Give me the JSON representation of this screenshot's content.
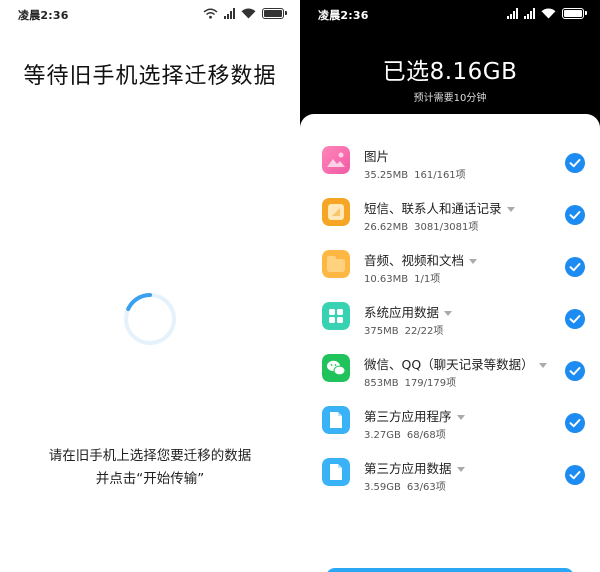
{
  "left": {
    "status_time": "凌晨2:36",
    "title": "等待旧手机选择迁移数据",
    "hint_line1": "请在旧手机上选择您要迁移的数据",
    "hint_line2": "并点击“开始传输”"
  },
  "right": {
    "status_time": "凌晨2:36",
    "title": "已选8.16GB",
    "subtitle": "预计需要10分钟",
    "items": [
      {
        "name": "图片",
        "size": "35.25MB",
        "count": "161/161项",
        "icon": "photos-icon",
        "has_caret": false,
        "checked": true
      },
      {
        "name": "短信、联系人和通话记录",
        "size": "26.62MB",
        "count": "3081/3081项",
        "icon": "messages-contacts-icon",
        "has_caret": true,
        "checked": true
      },
      {
        "name": "音频、视频和文档",
        "size": "10.63MB",
        "count": "1/1项",
        "icon": "media-documents-icon",
        "has_caret": true,
        "checked": true
      },
      {
        "name": "系统应用数据",
        "size": "375MB",
        "count": "22/22项",
        "icon": "system-apps-icon",
        "has_caret": true,
        "checked": true
      },
      {
        "name": "微信、QQ（聊天记录等数据）",
        "size": "853MB",
        "count": "179/179项",
        "icon": "wechat-icon",
        "has_caret": true,
        "checked": true
      },
      {
        "name": "第三方应用程序",
        "size": "3.27GB",
        "count": "68/68项",
        "icon": "third-party-apps-icon",
        "has_caret": true,
        "checked": true
      },
      {
        "name": "第三方应用数据",
        "size": "3.59GB",
        "count": "63/63项",
        "icon": "third-party-data-icon",
        "has_caret": true,
        "checked": true
      }
    ]
  },
  "colors": {
    "check_blue": "#1c8cf2",
    "button_blue": "#2ba7f5",
    "spinner_blue": "#3aa0f0"
  }
}
